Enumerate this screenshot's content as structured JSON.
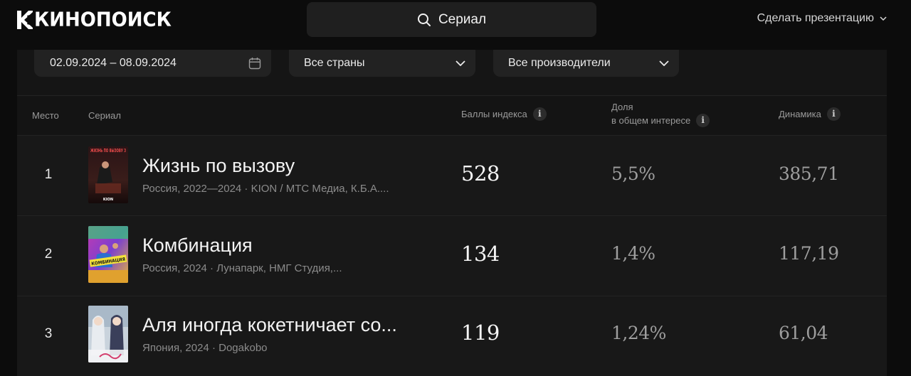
{
  "header": {
    "logo_text": "КИНОПОИСК",
    "search_label": "Сериал",
    "present_label": "Сделать презентацию"
  },
  "filters": {
    "date_range": "02.09.2024 – 08.09.2024",
    "country": "Все страны",
    "producer": "Все производители"
  },
  "columns": {
    "place": "Место",
    "series": "Сериал",
    "score": "Баллы индекса",
    "share_line1": "Доля",
    "share_line2": "в общем интересе",
    "dynamics": "Динамика"
  },
  "rows": [
    {
      "rank": "1",
      "title": "Жизнь по вызову",
      "meta": "Россия, 2022—2024 · KION / МТС Медиа, К.Б.А....",
      "score": "528",
      "share": "5,5%",
      "dynamics": "385,71",
      "poster_caption": "ЖИЗНЬ ПО ВЫЗОВУ 3",
      "poster_brand": "KION"
    },
    {
      "rank": "2",
      "title": "Комбинация",
      "meta": "Россия, 2024 · Лунапарк, НМГ Студия,...",
      "score": "134",
      "share": "1,4%",
      "dynamics": "117,19",
      "poster_caption": "КОМБИНАЦИЯ"
    },
    {
      "rank": "3",
      "title": "Аля иногда кокетничает со...",
      "meta": "Япония, 2024 · Dogakobo",
      "score": "119",
      "share": "1,24%",
      "dynamics": "61,04"
    }
  ],
  "icons": {
    "search": "search-icon",
    "calendar": "calendar-icon",
    "chevron": "chevron-down-icon",
    "info": "info-icon"
  },
  "colors": {
    "page_bg": "#0c0c0c",
    "panel_bg": "#141414",
    "row_bg": "#181818",
    "control_bg": "#222222"
  }
}
